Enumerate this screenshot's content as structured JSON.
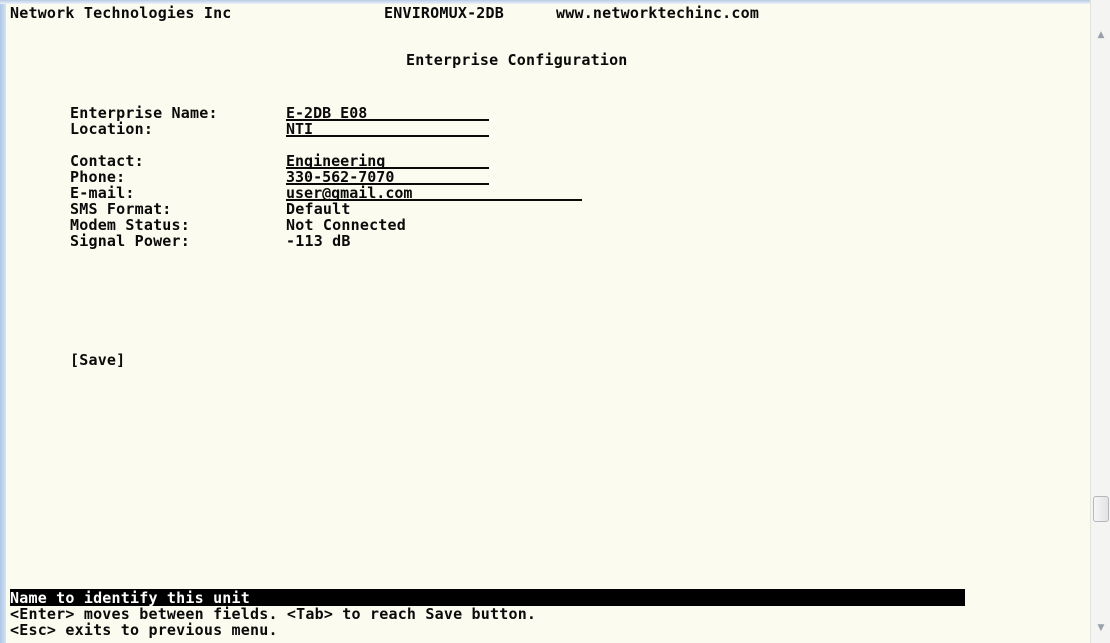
{
  "header": {
    "company": "Network Technologies Inc",
    "product": "ENVIROMUX-2DB",
    "website": "www.networktechinc.com"
  },
  "page_title": "Enterprise Configuration",
  "fields": {
    "enterprise_name": {
      "label": "Enterprise Name:",
      "value": "E-2DB E08"
    },
    "location": {
      "label": "Location:",
      "value": "NTI"
    },
    "contact": {
      "label": "Contact:",
      "value": "Engineering"
    },
    "phone": {
      "label": "Phone:",
      "value": "330-562-7070"
    },
    "email": {
      "label": "E-mail:",
      "value": "user@gmail.com"
    },
    "sms_format": {
      "label": "SMS Format:",
      "value": "Default"
    },
    "modem_status": {
      "label": "Modem Status:",
      "value": "Not Connected"
    },
    "signal_power": {
      "label": "Signal Power:",
      "value": "-113 dB"
    }
  },
  "save_button": {
    "label": "[Save]"
  },
  "help": {
    "field_hint": "Name to identify this unit",
    "line1": "<Enter> moves between fields. <Tab> to reach Save button.",
    "line2": "<Esc> exits to previous menu."
  },
  "colors": {
    "background": "#fbfbef",
    "text": "#0a0a0a",
    "highlight_bar": "#000000",
    "highlight_text": "#ffffff"
  },
  "icons": {
    "scroll_up": "up-arrow-icon",
    "scroll_down": "down-arrow-icon"
  }
}
